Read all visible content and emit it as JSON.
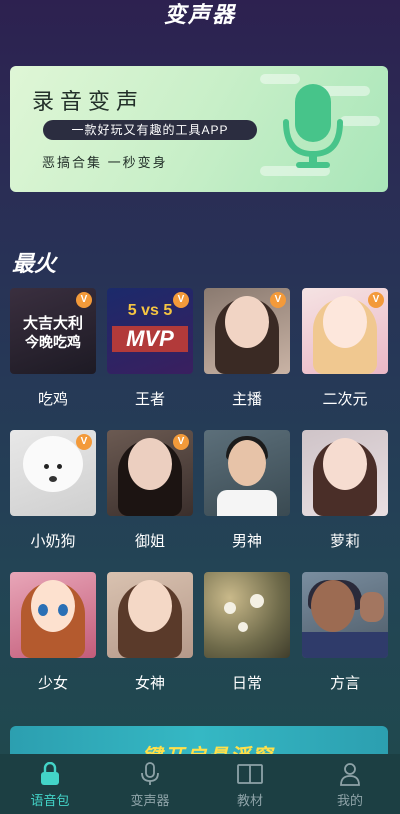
{
  "app": {
    "title": "变声器"
  },
  "banner": {
    "title": "录音变声",
    "tagline": "一款好玩又有趣的工具APP",
    "subtitle": "恶搞合集  一秒变身"
  },
  "section": {
    "title": "最火"
  },
  "items": [
    {
      "label": "吃鸡",
      "thumb_text_1": "大吉大利",
      "thumb_text_2": "今晚吃鸡",
      "vip": "V"
    },
    {
      "label": "王者",
      "thumb_text_1": "5 vs 5",
      "thumb_text_2": "MVP",
      "vip": "V"
    },
    {
      "label": "主播",
      "vip": "V"
    },
    {
      "label": "二次元",
      "vip": "V"
    },
    {
      "label": "小奶狗",
      "vip": "V"
    },
    {
      "label": "御姐",
      "vip": "V"
    },
    {
      "label": "男神"
    },
    {
      "label": "萝莉"
    },
    {
      "label": "少女"
    },
    {
      "label": "女神"
    },
    {
      "label": "日常"
    },
    {
      "label": "方言"
    }
  ],
  "promo": {
    "text": "一键开启悬浮窗"
  },
  "tabs": [
    {
      "label": "语音包",
      "icon": "lock-bag-icon",
      "active": true
    },
    {
      "label": "变声器",
      "icon": "microphone-icon",
      "active": false
    },
    {
      "label": "教材",
      "icon": "book-icon",
      "active": false
    },
    {
      "label": "我的",
      "icon": "person-icon",
      "active": false
    }
  ],
  "colors": {
    "accent": "#43d4c8",
    "vip_badge": "#f39a3a"
  }
}
